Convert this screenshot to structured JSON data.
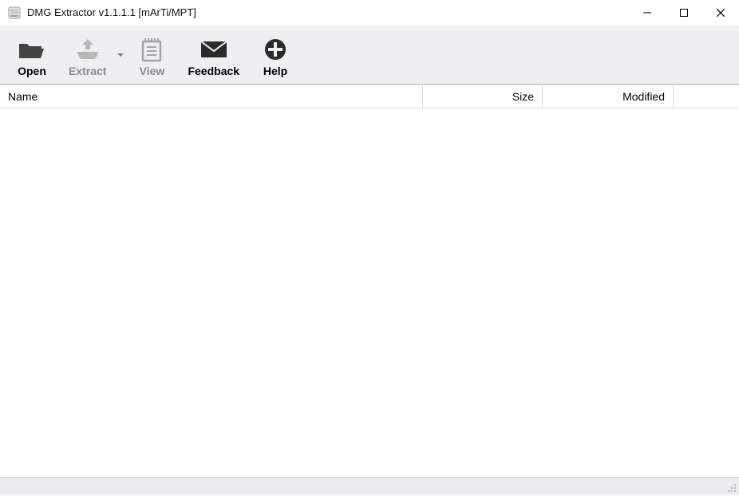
{
  "window": {
    "title": "DMG Extractor v1.1.1.1 [mArTi/MPT]"
  },
  "toolbar": {
    "open_label": "Open",
    "extract_label": "Extract",
    "view_label": "View",
    "feedback_label": "Feedback",
    "help_label": "Help"
  },
  "columns": {
    "name": "Name",
    "size": "Size",
    "modified": "Modified"
  },
  "rows": [],
  "statusbar": {
    "text": ""
  }
}
